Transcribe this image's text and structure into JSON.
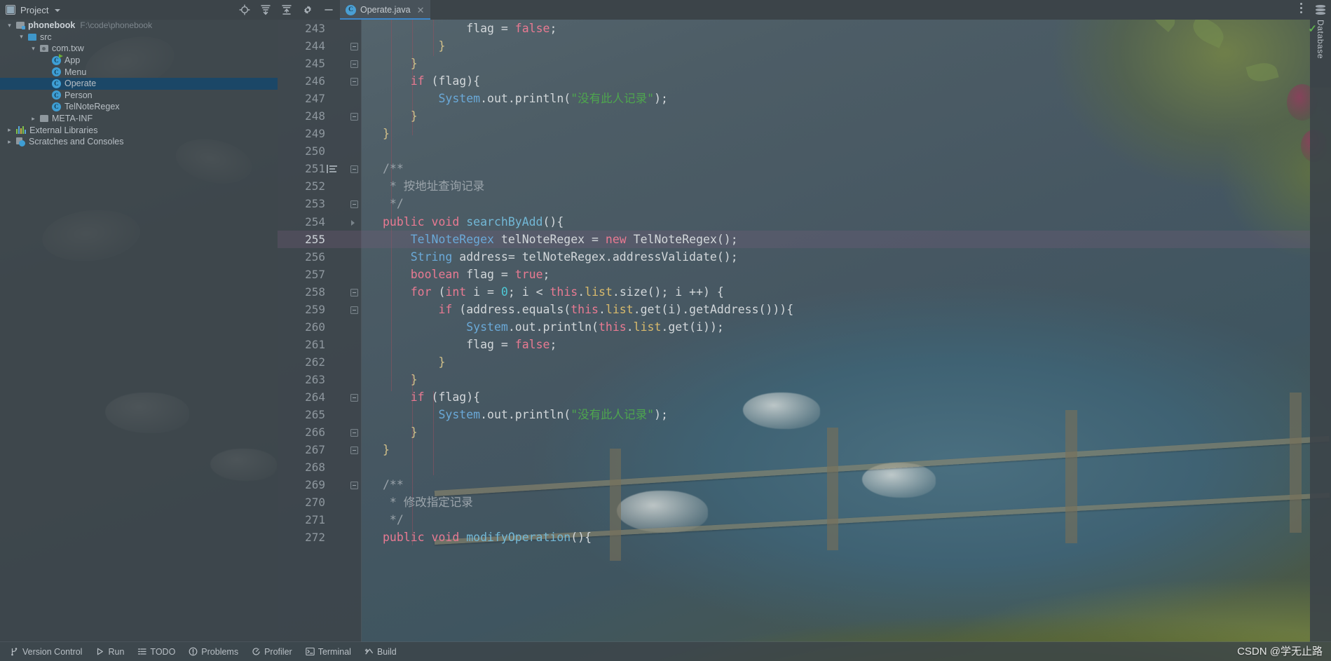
{
  "window": {
    "title": "Operate.java"
  },
  "toolwindow": {
    "label": "Project",
    "caret_icon": "chevron-down-icon",
    "buttons": [
      {
        "name": "locate-icon",
        "title": "Select Opened File"
      },
      {
        "name": "expand-all-icon",
        "title": "Expand All"
      },
      {
        "name": "collapse-all-icon",
        "title": "Collapse All"
      },
      {
        "name": "gear-icon",
        "title": "Settings"
      },
      {
        "name": "minimize-icon",
        "title": "Hide"
      }
    ]
  },
  "tabs": [
    {
      "label": "Operate.java",
      "icon": "java-class-icon",
      "close_icon": "close-icon",
      "active": true
    }
  ],
  "project_tree": [
    {
      "indent": 0,
      "arrow": "open",
      "icon": "module-folder-icon",
      "label": "phonebook",
      "path": "F:\\code\\phonebook",
      "bold": true,
      "selected": false
    },
    {
      "indent": 1,
      "arrow": "open",
      "icon": "source-folder-icon",
      "label": "src",
      "path": "",
      "bold": false,
      "selected": false
    },
    {
      "indent": 2,
      "arrow": "open",
      "icon": "package-icon",
      "label": "com.txw",
      "path": "",
      "bold": false,
      "selected": false
    },
    {
      "indent": 3,
      "arrow": "blank",
      "icon": "java-class-runnable-icon",
      "label": "App",
      "path": "",
      "bold": false,
      "selected": false
    },
    {
      "indent": 3,
      "arrow": "blank",
      "icon": "java-class-icon",
      "label": "Menu",
      "path": "",
      "bold": false,
      "selected": false
    },
    {
      "indent": 3,
      "arrow": "blank",
      "icon": "java-class-icon",
      "label": "Operate",
      "path": "",
      "bold": false,
      "selected": true
    },
    {
      "indent": 3,
      "arrow": "blank",
      "icon": "java-class-icon",
      "label": "Person",
      "path": "",
      "bold": false,
      "selected": false
    },
    {
      "indent": 3,
      "arrow": "blank",
      "icon": "java-class-icon",
      "label": "TelNoteRegex",
      "path": "",
      "bold": false,
      "selected": false
    },
    {
      "indent": 2,
      "arrow": "closed",
      "icon": "folder-icon",
      "label": "META-INF",
      "path": "",
      "bold": false,
      "selected": false
    },
    {
      "indent": 0,
      "arrow": "closed",
      "icon": "libraries-icon",
      "label": "External Libraries",
      "path": "",
      "bold": false,
      "selected": false
    },
    {
      "indent": 0,
      "arrow": "closed",
      "icon": "scratches-icon",
      "label": "Scratches and Consoles",
      "path": "",
      "bold": false,
      "selected": false
    }
  ],
  "editor": {
    "file": "Operate.java",
    "first_line": 243,
    "caret_line": 255,
    "lines": [
      {
        "n": 243,
        "fold": "",
        "doc": false,
        "tokens": [
          {
            "t": "            ",
            "c": "pln"
          },
          {
            "t": "flag ",
            "c": "pln"
          },
          {
            "t": "= ",
            "c": "pln"
          },
          {
            "t": "false",
            "c": "kw"
          },
          {
            "t": ";",
            "c": "pln"
          }
        ]
      },
      {
        "n": 244,
        "fold": "minus",
        "doc": false,
        "tokens": [
          {
            "t": "        ",
            "c": "pln"
          },
          {
            "t": "}",
            "c": "punc"
          }
        ]
      },
      {
        "n": 245,
        "fold": "minus",
        "doc": false,
        "tokens": [
          {
            "t": "    ",
            "c": "pln"
          },
          {
            "t": "}",
            "c": "punc"
          }
        ]
      },
      {
        "n": 246,
        "fold": "minus",
        "doc": false,
        "tokens": [
          {
            "t": "    ",
            "c": "pln"
          },
          {
            "t": "if",
            "c": "kw"
          },
          {
            "t": " (flag){",
            "c": "pln"
          }
        ]
      },
      {
        "n": 247,
        "fold": "",
        "doc": false,
        "tokens": [
          {
            "t": "        ",
            "c": "pln"
          },
          {
            "t": "System",
            "c": "cls"
          },
          {
            "t": ".out.println(",
            "c": "pln"
          },
          {
            "t": "\"没有此人记录\"",
            "c": "str"
          },
          {
            "t": ");",
            "c": "pln"
          }
        ]
      },
      {
        "n": 248,
        "fold": "minus",
        "doc": false,
        "tokens": [
          {
            "t": "    ",
            "c": "pln"
          },
          {
            "t": "}",
            "c": "punc"
          }
        ]
      },
      {
        "n": 249,
        "fold": "",
        "doc": false,
        "tokens": [
          {
            "t": "}",
            "c": "punc"
          }
        ]
      },
      {
        "n": 250,
        "fold": "",
        "doc": false,
        "tokens": []
      },
      {
        "n": 251,
        "fold": "minus",
        "doc": true,
        "tokens": [
          {
            "t": "/**",
            "c": "cmt"
          }
        ]
      },
      {
        "n": 252,
        "fold": "",
        "doc": false,
        "tokens": [
          {
            "t": " * 按地址查询记录",
            "c": "cmt"
          }
        ]
      },
      {
        "n": 253,
        "fold": "minus",
        "doc": false,
        "tokens": [
          {
            "t": " */",
            "c": "cmt"
          }
        ]
      },
      {
        "n": 254,
        "fold": "tri",
        "doc": false,
        "tokens": [
          {
            "t": "public void ",
            "c": "kw"
          },
          {
            "t": "searchByAdd",
            "c": "meth"
          },
          {
            "t": "(){",
            "c": "pln"
          }
        ]
      },
      {
        "n": 255,
        "fold": "",
        "doc": false,
        "hl": true,
        "tokens": [
          {
            "t": "    ",
            "c": "pln"
          },
          {
            "t": "TelNoteRegex",
            "c": "cls"
          },
          {
            "t": " telNoteRegex = ",
            "c": "pln"
          },
          {
            "t": "new",
            "c": "kw"
          },
          {
            "t": " TelNoteRegex();",
            "c": "pln"
          }
        ]
      },
      {
        "n": 256,
        "fold": "",
        "doc": false,
        "tokens": [
          {
            "t": "    ",
            "c": "pln"
          },
          {
            "t": "String",
            "c": "cls"
          },
          {
            "t": " address= telNoteRegex.addressValidate();",
            "c": "pln"
          }
        ]
      },
      {
        "n": 257,
        "fold": "",
        "doc": false,
        "tokens": [
          {
            "t": "    ",
            "c": "pln"
          },
          {
            "t": "boolean",
            "c": "kw"
          },
          {
            "t": " flag = ",
            "c": "pln"
          },
          {
            "t": "true",
            "c": "kw"
          },
          {
            "t": ";",
            "c": "pln"
          }
        ]
      },
      {
        "n": 258,
        "fold": "minus",
        "doc": false,
        "tokens": [
          {
            "t": "    ",
            "c": "pln"
          },
          {
            "t": "for",
            "c": "kw"
          },
          {
            "t": " (",
            "c": "pln"
          },
          {
            "t": "int",
            "c": "kw"
          },
          {
            "t": " i = ",
            "c": "pln"
          },
          {
            "t": "0",
            "c": "num"
          },
          {
            "t": "; i < ",
            "c": "pln"
          },
          {
            "t": "this",
            "c": "thi"
          },
          {
            "t": ".",
            "c": "pln"
          },
          {
            "t": "list",
            "c": "fld"
          },
          {
            "t": ".size(); i ++) {",
            "c": "pln"
          }
        ]
      },
      {
        "n": 259,
        "fold": "minus",
        "doc": false,
        "tokens": [
          {
            "t": "        ",
            "c": "pln"
          },
          {
            "t": "if",
            "c": "kw"
          },
          {
            "t": " (address.equals(",
            "c": "pln"
          },
          {
            "t": "this",
            "c": "thi"
          },
          {
            "t": ".",
            "c": "pln"
          },
          {
            "t": "list",
            "c": "fld"
          },
          {
            "t": ".get(i).getAddress())){",
            "c": "pln"
          }
        ]
      },
      {
        "n": 260,
        "fold": "",
        "doc": false,
        "tokens": [
          {
            "t": "            ",
            "c": "pln"
          },
          {
            "t": "System",
            "c": "cls"
          },
          {
            "t": ".out.println(",
            "c": "pln"
          },
          {
            "t": "this",
            "c": "thi"
          },
          {
            "t": ".",
            "c": "pln"
          },
          {
            "t": "list",
            "c": "fld"
          },
          {
            "t": ".get(i));",
            "c": "pln"
          }
        ]
      },
      {
        "n": 261,
        "fold": "",
        "doc": false,
        "tokens": [
          {
            "t": "            ",
            "c": "pln"
          },
          {
            "t": "flag = ",
            "c": "pln"
          },
          {
            "t": "false",
            "c": "kw"
          },
          {
            "t": ";",
            "c": "pln"
          }
        ]
      },
      {
        "n": 262,
        "fold": "",
        "doc": false,
        "tokens": [
          {
            "t": "        ",
            "c": "pln"
          },
          {
            "t": "}",
            "c": "punc"
          }
        ]
      },
      {
        "n": 263,
        "fold": "",
        "doc": false,
        "tokens": [
          {
            "t": "    ",
            "c": "pln"
          },
          {
            "t": "}",
            "c": "punc"
          }
        ]
      },
      {
        "n": 264,
        "fold": "minus",
        "doc": false,
        "tokens": [
          {
            "t": "    ",
            "c": "pln"
          },
          {
            "t": "if",
            "c": "kw"
          },
          {
            "t": " (flag){",
            "c": "pln"
          }
        ]
      },
      {
        "n": 265,
        "fold": "",
        "doc": false,
        "tokens": [
          {
            "t": "        ",
            "c": "pln"
          },
          {
            "t": "System",
            "c": "cls"
          },
          {
            "t": ".out.println(",
            "c": "pln"
          },
          {
            "t": "\"没有此人记录\"",
            "c": "str"
          },
          {
            "t": ");",
            "c": "pln"
          }
        ]
      },
      {
        "n": 266,
        "fold": "minus",
        "doc": false,
        "tokens": [
          {
            "t": "    ",
            "c": "pln"
          },
          {
            "t": "}",
            "c": "punc"
          }
        ]
      },
      {
        "n": 267,
        "fold": "minus",
        "doc": false,
        "tokens": [
          {
            "t": "}",
            "c": "punc"
          }
        ]
      },
      {
        "n": 268,
        "fold": "",
        "doc": false,
        "tokens": []
      },
      {
        "n": 269,
        "fold": "minus",
        "doc": false,
        "tokens": [
          {
            "t": "/**",
            "c": "cmt"
          }
        ]
      },
      {
        "n": 270,
        "fold": "",
        "doc": false,
        "tokens": [
          {
            "t": " * 修改指定记录",
            "c": "cmt"
          }
        ]
      },
      {
        "n": 271,
        "fold": "",
        "doc": false,
        "tokens": [
          {
            "t": " */",
            "c": "cmt"
          }
        ]
      },
      {
        "n": 272,
        "fold": "",
        "doc": false,
        "tokens": [
          {
            "t": "public void ",
            "c": "kw"
          },
          {
            "t": "modifyOperation",
            "c": "meth"
          },
          {
            "t": "(){",
            "c": "pln"
          }
        ]
      }
    ]
  },
  "right_tool": {
    "label": "Database",
    "icon": "database-icon",
    "status_icon": "check-icon",
    "more_icon": "more-vertical-icon"
  },
  "statusbar": {
    "items": [
      {
        "label": "Version Control",
        "icon": "branch-icon"
      },
      {
        "label": "Run",
        "icon": "run-icon"
      },
      {
        "label": "TODO",
        "icon": "todo-icon"
      },
      {
        "label": "Problems",
        "icon": "problems-icon"
      },
      {
        "label": "Profiler",
        "icon": "profiler-icon"
      },
      {
        "label": "Terminal",
        "icon": "terminal-icon"
      },
      {
        "label": "Build",
        "icon": "build-icon"
      }
    ]
  },
  "watermark": "CSDN @学无止路",
  "colors": {
    "accent": "#3d86c9",
    "selection": "#1b4767",
    "caret_row": "#745e7c",
    "keyword": "#e97a92",
    "string": "#4ea64e",
    "class": "#6aa9d8",
    "method": "#72b8d6",
    "number": "#4ec9d6",
    "field": "#d8ba6c",
    "comment": "#9aa3aa",
    "plain": "#d2d7da"
  }
}
